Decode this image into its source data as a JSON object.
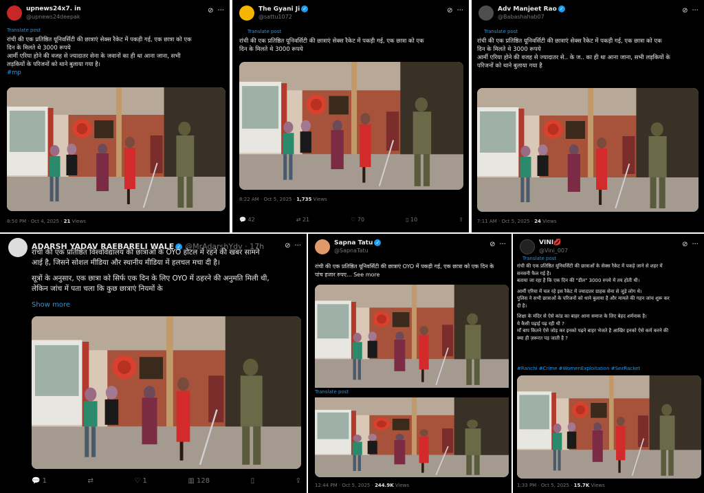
{
  "common": {
    "translate_label": "Translate post"
  },
  "tweet1": {
    "name": "upnews24x7. in",
    "handle": "@upnews24deepak",
    "text_lines": [
      "रांची की एक प्रतिष्ठित यूनिवर्सिटी की छात्राएं सेक्स रैकेट में पकड़ी गई, एक छात्रा को एक",
      "दिन के मिलते थे 3000 रूपये",
      "आर्मी एरिया होने की वजह से ज्यादातर सेना के जवानों का ही था आना जाना, सभी",
      "लड़कियों के परिजनों को थाने बुलाया गया है।"
    ],
    "hashtag": "#mp",
    "time": "8:50 PM · Oct 4, 2025 · ",
    "views_count": "21",
    "views_label": " Views"
  },
  "tweet2": {
    "name": "The Gyani Ji",
    "handle": "@sattu1072",
    "text_lines": [
      "रांची की एक प्रतिष्ठित यूनिवर्सिटी की छात्राएं सेक्स रैकेट में पकड़ी गई, एक छात्रा को एक",
      "दिन के मिलते थे 3000 रूपये"
    ],
    "time": "8:22 AM · Oct 5, 2025 · ",
    "views_count": "1,735",
    "views_label": " Views",
    "replies": "42",
    "reposts": "21",
    "likes": "70",
    "bookmarks": "10"
  },
  "tweet3": {
    "name": "Adv Manjeet Rao",
    "handle": "@Babashahab07",
    "text_lines": [
      "रांची की एक प्रतिष्ठित यूनिवर्सिटी की छात्राएं सेक्स रैकेट में पकड़ी गई, एक छात्रा को एक",
      "दिन के मिलते थे 3000 रूपये",
      "आर्मी एरिया होने की वजह से ज्यादातर से.. के ज.. का ही था आना जाना, सभी लड़कियों के",
      "परिजनों को थाने बुलाया गया है"
    ],
    "time": "7:11 AM · Oct 5, 2025 · ",
    "views_count": "24",
    "views_label": " Views"
  },
  "tweet4": {
    "name": "ADARSH YADAV RAEBARELI WALE",
    "handle": "@MrAdarshYdv · 17h",
    "text_lines": [
      "रांची की एक प्रतिष्ठित विश्वविद्यालय की छात्राओं के OYO होटल में रहने की खबर सामने",
      "आई है, जिसने सोशल मीडिया और स्थानीय मीडिया में हलचल मचा दी है।",
      "",
      "सूत्रों के अनुसार, एक छात्रा को सिर्फ एक दिन के लिए OYO में ठहरने की अनुमति मिली थी,",
      "लेकिन जांच में पता चला कि कुछ छात्राएं नियमों के"
    ],
    "show_more": "Show more",
    "replies": "1",
    "likes": "1",
    "views": "128"
  },
  "tweet5": {
    "name": "Sapna Tatu",
    "handle": "@SapnaTatu",
    "text_lines": [
      "रांची की एक प्रतिष्ठित यूनिवर्सिटी की छात्राएं OYO में पकड़ी गई, एक छात्रा को एक दिन के",
      "पांच हजार रुपए... See more"
    ],
    "time": "12:44 PM · Oct 5, 2025 · ",
    "views_count": "244.9K",
    "views_label": " Views"
  },
  "tweet6": {
    "name": "VINI💋",
    "handle": "@Vini_007",
    "text_lines": [
      "रांची की एक प्रतिष्ठित यूनिवर्सिटी की छात्राओं के सेक्स रैकेट में पकड़े जाने से शहर में",
      "सनसनी फैल गई है।",
      "बताया जा रहा है कि एक दिन की \"डील\" 3000 रुपये में तय होती थी।",
      "",
      "आर्मी एरिया में चल रहे इस रैकेट में ज्यादातर ग्राहक सेना से जुड़े लोग थे।",
      "पुलिस ने सभी छात्राओं के परिजनों को थाने बुलाया है और मामले की गहन जांच शुरू कर",
      "दी है।",
      "",
      "शिक्षा के मंदिर से ऐसे कांड का बाहर आना समाज के लिए बेहद शर्मनाक है।",
      "ये कैसी पढ़ाई पढ़ रही थी ?",
      "माँ बाप कितने ऐसे जोड़ कर इनको पढ़ने बाहर भेजते है आखिर इनको ऐसे कर्म करने की",
      "क्या ही ज़रूरत पड़ जाती है ?"
    ],
    "hashtags": "#Ranchi #Crime #WomenExploitation #SexRacket",
    "time": "1:33 PM · Oct 5, 2025 · ",
    "views_count": "15.7K",
    "views_label": " Views"
  },
  "photo": {
    "sign_text": "Wal-a-B"
  },
  "colors": {
    "bg": "#000000",
    "text": "#e7e9ea",
    "muted": "#71767b",
    "link": "#1d9bf0"
  }
}
